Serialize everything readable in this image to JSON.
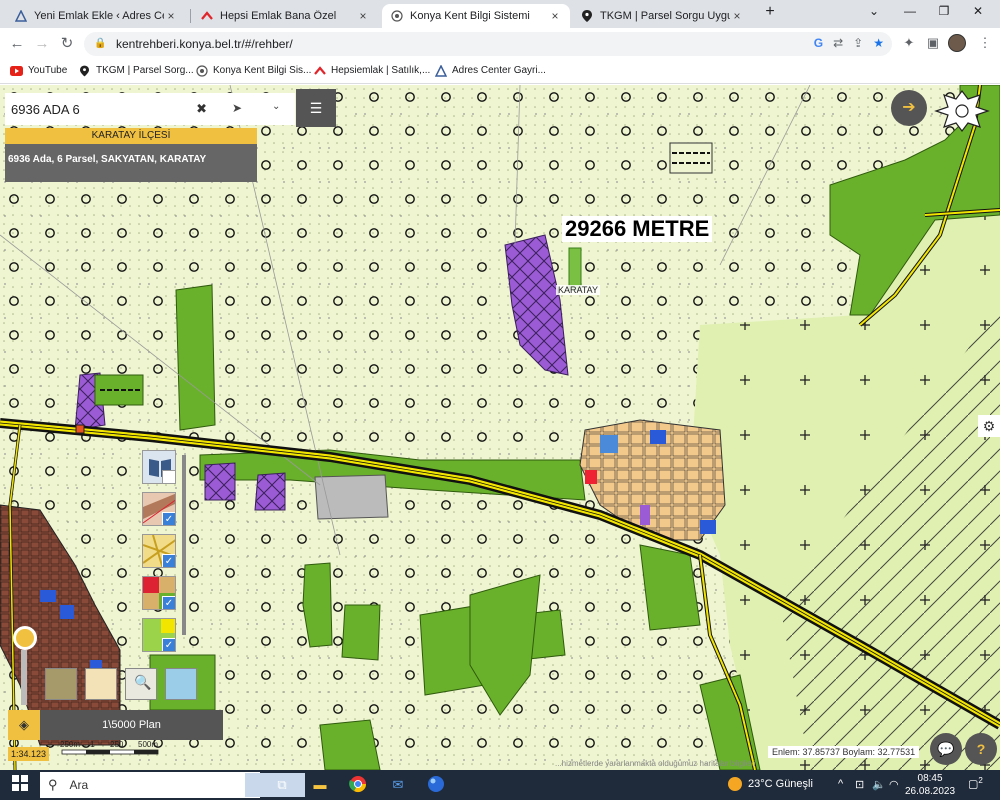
{
  "browser": {
    "tabs": [
      {
        "label": "Yeni Emlak Ekle ‹ Adres Center Gayr",
        "icon": "triangle-icon"
      },
      {
        "label": "Hepsi Emlak Bana Özel",
        "icon": "hepsiemlak-icon"
      },
      {
        "label": "Konya Kent Bilgi Sistemi",
        "icon": "konya-icon"
      },
      {
        "label": "TKGM | Parsel Sorgu Uygulaması",
        "icon": "pin-icon"
      }
    ],
    "url": "kentrehberi.konya.bel.tr/#/rehber/",
    "bookmarks": [
      "YouTube",
      "TKGM | Parsel Sorg...",
      "Konya Kent Bilgi Sis...",
      "Hepsiemlak | Satılık,...",
      "Adres Center Gayri..."
    ]
  },
  "map": {
    "search_value": "6936 ADA 6",
    "district_header": "KARATAY İLÇESİ",
    "parcel_info": "6936 Ada, 6 Parsel, SAKYATAN, KARATAY",
    "distance_label": "29266 METRE",
    "town_label": "KARATAY",
    "plan_label": "1\\5000 Plan",
    "scale_labels": [
      "250m",
      "1",
      "250",
      "500m"
    ],
    "scale_ratio": "1:34.123",
    "coordinates": "Enlem: 37.85737 Boylam: 32.77531",
    "attribution": "...hizmetlerde yararlanmakta olduğumuz haritalar bilgileri"
  },
  "taskbar": {
    "search_placeholder": "Ara",
    "weather": "23°C  Güneşli",
    "time": "08:45",
    "date": "26.08.2023",
    "notifications": "2"
  },
  "colors": {
    "map_background": "#eef5d0",
    "green_zone": "#6ab12b",
    "purple_zone": "#9b5bd4",
    "road_yellow": "#f2e600",
    "accent": "#f0c040"
  }
}
